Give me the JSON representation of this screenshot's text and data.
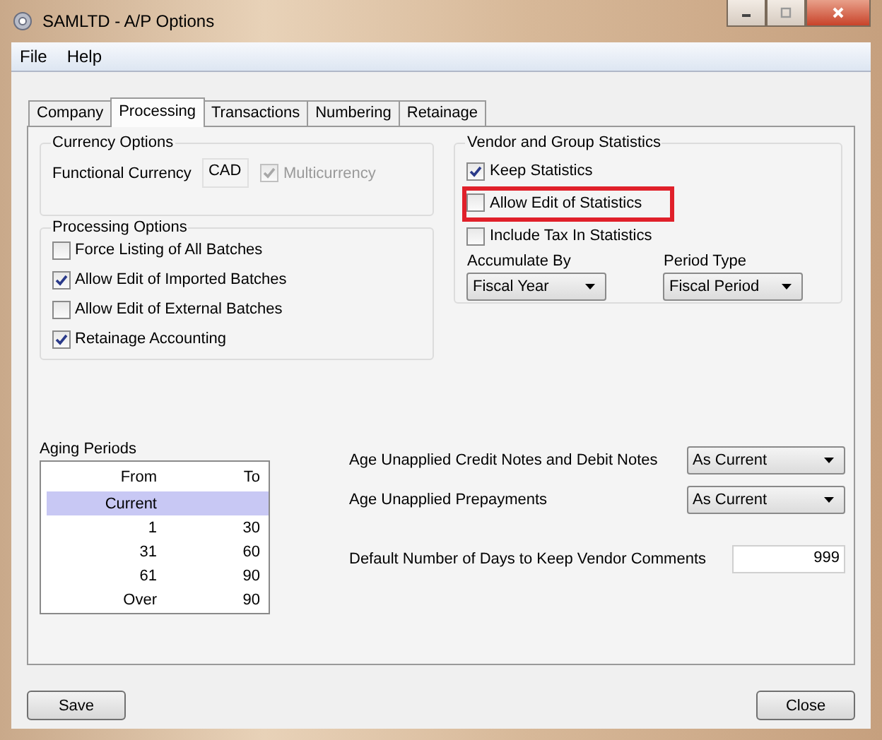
{
  "window": {
    "title": "SAMLTD - A/P Options"
  },
  "menu": [
    {
      "label": "File"
    },
    {
      "label": "Help"
    }
  ],
  "tabs": [
    {
      "label": "Company",
      "selected": false
    },
    {
      "label": "Processing",
      "selected": true
    },
    {
      "label": "Transactions",
      "selected": false
    },
    {
      "label": "Numbering",
      "selected": false
    },
    {
      "label": "Retainage",
      "selected": false
    }
  ],
  "currency_options": {
    "title": "Currency Options",
    "functional_currency_label": "Functional Currency",
    "functional_currency": "CAD",
    "multicurrency": {
      "label": "Multicurrency",
      "checked": true,
      "disabled": true
    }
  },
  "processing_options": {
    "title": "Processing Options",
    "items": [
      {
        "label": "Force Listing of All Batches",
        "checked": false
      },
      {
        "label": "Allow Edit of Imported Batches",
        "checked": true
      },
      {
        "label": "Allow Edit of External Batches",
        "checked": false
      },
      {
        "label": "Retainage Accounting",
        "checked": true
      }
    ]
  },
  "vendor_statistics": {
    "title": "Vendor and Group Statistics",
    "items": [
      {
        "label": "Keep Statistics",
        "checked": true,
        "highlighted": false
      },
      {
        "label": "Allow Edit of Statistics",
        "checked": false,
        "highlighted": true
      },
      {
        "label": "Include Tax In Statistics",
        "checked": false,
        "highlighted": false
      }
    ],
    "accumulate_by": {
      "label": "Accumulate By",
      "value": "Fiscal Year"
    },
    "period_type": {
      "label": "Period Type",
      "value": "Fiscal Period"
    }
  },
  "aging_periods": {
    "title": "Aging Periods",
    "columns": [
      "From",
      "To"
    ],
    "rows": [
      {
        "from": "Current",
        "selected": true
      },
      {
        "from": "1",
        "to": "30",
        "selected": false
      },
      {
        "from": "31",
        "to": "60",
        "selected": false
      },
      {
        "from": "61",
        "to": "90",
        "selected": false
      },
      {
        "from": "Over",
        "to": "90",
        "selected": false
      }
    ]
  },
  "settings": [
    {
      "kind": "dropdown",
      "label": "Age Unapplied Credit Notes and Debit Notes",
      "value": "As Current"
    },
    {
      "kind": "dropdown",
      "label": "Age Unapplied Prepayments",
      "value": "As Current"
    },
    {
      "kind": "number",
      "label": "Default Number of Days to Keep Vendor Comments",
      "value": "999"
    }
  ],
  "buttons": [
    {
      "label": "Save"
    },
    {
      "label": "Close"
    }
  ]
}
